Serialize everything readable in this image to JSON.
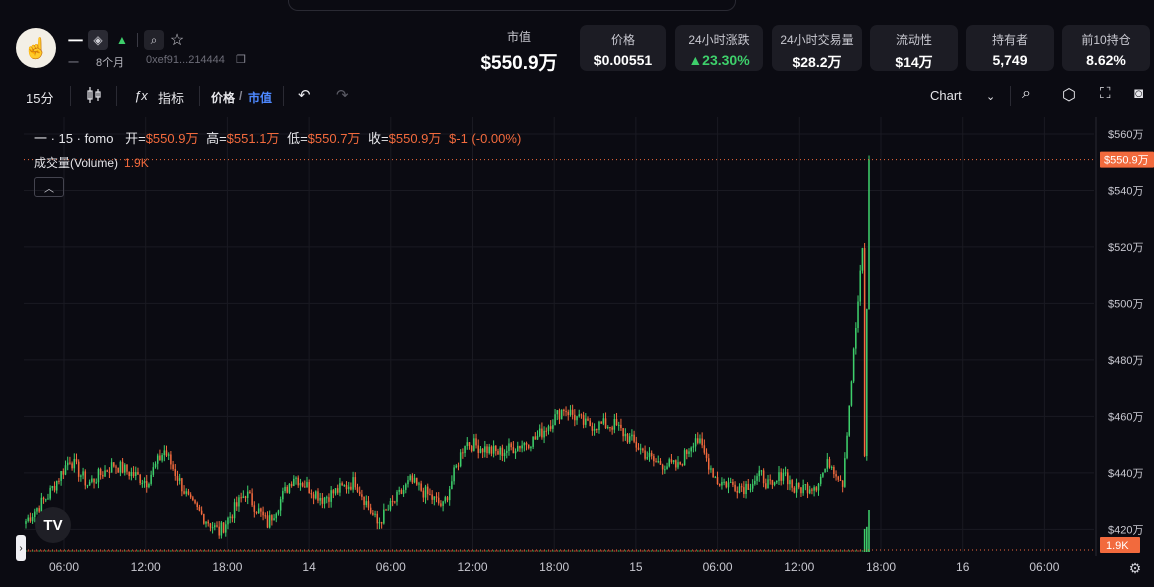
{
  "token": {
    "name": "一",
    "sub_name": "一",
    "age": "8个月",
    "address": "0xef91...214444",
    "icons": [
      "chain-icon",
      "launchpad-icon",
      "search-icon",
      "star-icon",
      "copy-icon"
    ]
  },
  "market_cap": {
    "label": "市值",
    "value": "$550.9万"
  },
  "stats": [
    {
      "label": "价格",
      "value": "$0.00551"
    },
    {
      "label": "24小时涨跌",
      "value": "▲23.30%",
      "color": "#3ecf6b"
    },
    {
      "label": "24小时交易量",
      "value": "$28.2万"
    },
    {
      "label": "流动性",
      "value": "$14万"
    },
    {
      "label": "持有者",
      "value": "5,749"
    },
    {
      "label": "前10持仓",
      "value": "8.62%"
    }
  ],
  "toolbar": {
    "interval": "15分",
    "indicators": "指标",
    "price": "价格",
    "slash": "/",
    "mcap": "市值",
    "chart": "Chart",
    "icons": [
      "candles-icon",
      "formula-icon",
      "undo-icon",
      "redo-icon",
      "chevron-down-icon",
      "zoom-icon",
      "settings-icon",
      "fullscreen-icon",
      "camera-icon"
    ]
  },
  "legend": {
    "symbol": "一 · 15 · fomo",
    "open_label": "开=",
    "open": "$550.9万",
    "high_label": "高=",
    "high": "$551.1万",
    "low_label": "低=",
    "low": "$550.7万",
    "close_label": "收=",
    "close": "$550.9万",
    "change": "$-1 (-0.00%)"
  },
  "volume": {
    "label": "成交量(Volume)",
    "value": "1.9K"
  },
  "tv_logo": "TV",
  "colors": {
    "up": "#3ecf6b",
    "down": "#f26a3d",
    "accent": "#4d88ff",
    "bg": "#0b0b12"
  },
  "chart_data": {
    "type": "candlestick",
    "y_ticks": [
      "$560万",
      "$540万",
      "$520万",
      "$500万",
      "$480万",
      "$460万",
      "$440万",
      "$420万"
    ],
    "y_values": [
      560,
      540,
      520,
      500,
      480,
      460,
      440,
      420
    ],
    "x_ticks": [
      "06:00",
      "12:00",
      "18:00",
      "14",
      "06:00",
      "12:00",
      "18:00",
      "15",
      "06:00",
      "12:00",
      "18:00",
      "16",
      "06:00"
    ],
    "last_price_label": "$550.9万",
    "last_price": 550.9,
    "last_volume_label": "1.9K",
    "ylim": [
      412,
      566
    ],
    "unit": "万",
    "anchors": [
      [
        0,
        423
      ],
      [
        10,
        432
      ],
      [
        20,
        445
      ],
      [
        28,
        436
      ],
      [
        40,
        443
      ],
      [
        55,
        437
      ],
      [
        63,
        448
      ],
      [
        75,
        429
      ],
      [
        88,
        419
      ],
      [
        100,
        433
      ],
      [
        110,
        422
      ],
      [
        122,
        439
      ],
      [
        135,
        431
      ],
      [
        150,
        437
      ],
      [
        160,
        422
      ],
      [
        175,
        437
      ],
      [
        190,
        428
      ],
      [
        200,
        451
      ],
      [
        215,
        447
      ],
      [
        232,
        452
      ],
      [
        245,
        463
      ],
      [
        255,
        457
      ],
      [
        268,
        457
      ],
      [
        286,
        444
      ],
      [
        297,
        442
      ],
      [
        305,
        453
      ],
      [
        315,
        437
      ],
      [
        327,
        435
      ],
      [
        335,
        439
      ],
      [
        340,
        434
      ],
      [
        345,
        441
      ],
      [
        350,
        434
      ],
      [
        360,
        436
      ],
      [
        366,
        444
      ],
      [
        372,
        437
      ],
      [
        384,
        546
      ]
    ],
    "volume_bars": [
      {
        "i": 382,
        "v": 0.55
      },
      {
        "i": 383,
        "v": 0.6
      },
      {
        "i": 384,
        "v": 1.0
      }
    ]
  }
}
